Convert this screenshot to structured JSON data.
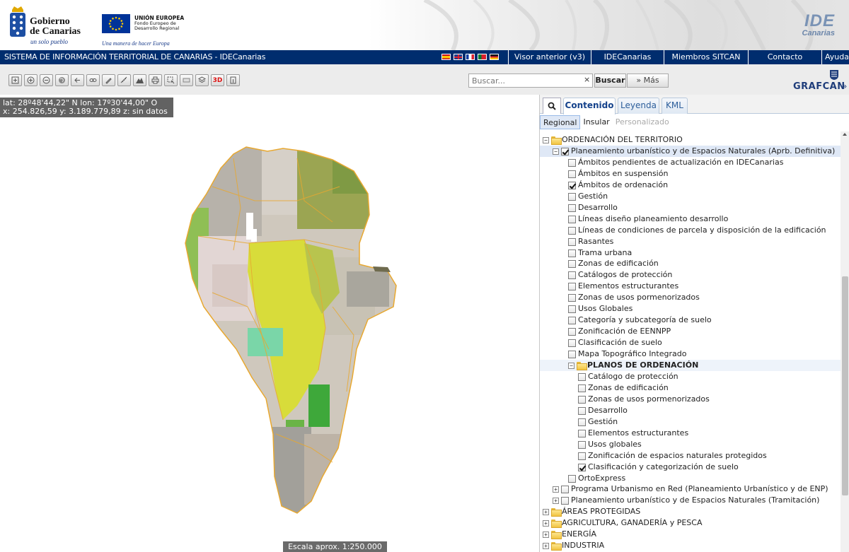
{
  "header": {
    "gob_name": "Gobierno\nde Canarias",
    "gob_slogan": "un solo pueblo",
    "ue_title": "UNIÓN EUROPEA",
    "ue_sub": "Fondo Europeo de\nDesarrollo Regional",
    "ue_slogan": "Una manera de hacer Europa",
    "ide_line1": "IDE",
    "ide_line2": "Canarias"
  },
  "navbar": {
    "system_title": "SISTEMA DE INFORMACIÓN TERRITORIAL DE CANARIAS - IDECanarias",
    "flags": [
      "es",
      "gb",
      "fr",
      "pt",
      "de"
    ],
    "links": [
      "Visor anterior (v3)",
      "IDECanarias",
      "Miembros SITCAN",
      "Contacto",
      "Ayuda"
    ]
  },
  "toolbar": {
    "tools": [
      "zoom-extent-icon",
      "zoom-in-icon",
      "zoom-out-icon",
      "globe-icon",
      "back-icon",
      "link-icon",
      "draw-icon",
      "measure-icon",
      "profile-icon",
      "print-icon",
      "select-icon",
      "legend-icon",
      "layers-icon",
      "3d-icon",
      "info-icon"
    ],
    "tool_3d_label": "3D",
    "search_placeholder": "Buscar...",
    "search_clear": "×",
    "search_button": "Buscar",
    "more_button": "» Más",
    "brand": "GRAFCAN",
    "brand_arrow": "»"
  },
  "map": {
    "coords_line1": "lat: 28º48'44,22\" N  lon: 17º30'44,00\" O",
    "coords_line2": "x: 254.826,59  y: 3.189.779,89  z: sin datos",
    "scale": "Escala aprox. 1:250.000"
  },
  "panel": {
    "tabs": [
      "Contenido",
      "Leyenda",
      "KML"
    ],
    "subtabs": [
      "Regional",
      "Insular",
      "Personalizado"
    ],
    "tree": [
      {
        "type": "folder",
        "level": 0,
        "expander": "−",
        "label": "ORDENACIÓN DEL TERRITORIO"
      },
      {
        "type": "layer",
        "level": 1,
        "expander": "−",
        "checked": true,
        "label": "Planeamiento urbanístico y de Espacios Naturales (Aprb. Definitiva)",
        "selected": true
      },
      {
        "type": "layer",
        "level": 2,
        "checked": false,
        "label": "Ámbitos pendientes de actualización en IDECanarias"
      },
      {
        "type": "layer",
        "level": 2,
        "checked": false,
        "label": "Ámbitos en suspensión"
      },
      {
        "type": "layer",
        "level": 2,
        "checked": true,
        "label": "Ámbitos de ordenación"
      },
      {
        "type": "layer",
        "level": 2,
        "checked": false,
        "label": "Gestión"
      },
      {
        "type": "layer",
        "level": 2,
        "checked": false,
        "label": "Desarrollo"
      },
      {
        "type": "layer",
        "level": 2,
        "checked": false,
        "label": "Líneas diseño planeamiento desarrollo"
      },
      {
        "type": "layer",
        "level": 2,
        "checked": false,
        "label": "Líneas de condiciones de parcela y disposición de la edificación"
      },
      {
        "type": "layer",
        "level": 2,
        "checked": false,
        "label": "Rasantes"
      },
      {
        "type": "layer",
        "level": 2,
        "checked": false,
        "label": "Trama urbana"
      },
      {
        "type": "layer",
        "level": 2,
        "checked": false,
        "label": "Zonas de edificación"
      },
      {
        "type": "layer",
        "level": 2,
        "checked": false,
        "label": "Catálogos de protección"
      },
      {
        "type": "layer",
        "level": 2,
        "checked": false,
        "label": "Elementos estructurantes"
      },
      {
        "type": "layer",
        "level": 2,
        "checked": false,
        "label": "Zonas de usos pormenorizados"
      },
      {
        "type": "layer",
        "level": 2,
        "checked": false,
        "label": "Usos Globales"
      },
      {
        "type": "layer",
        "level": 2,
        "checked": false,
        "label": "Categoría y subcategoría de suelo"
      },
      {
        "type": "layer",
        "level": 2,
        "checked": false,
        "label": "Zonificación de EENNPP"
      },
      {
        "type": "layer",
        "level": 2,
        "checked": false,
        "label": "Clasificación de suelo"
      },
      {
        "type": "layer",
        "level": 2,
        "checked": false,
        "label": "Mapa Topográfico Integrado"
      },
      {
        "type": "folder",
        "level": 2,
        "expander": "−",
        "label": "PLANOS DE ORDENACIÓN",
        "bold": true,
        "highlight": true
      },
      {
        "type": "layer",
        "level": 3,
        "checked": false,
        "label": "Catálogo de protección"
      },
      {
        "type": "layer",
        "level": 3,
        "checked": false,
        "label": "Zonas de edificación"
      },
      {
        "type": "layer",
        "level": 3,
        "checked": false,
        "label": "Zonas de usos pormenorizados"
      },
      {
        "type": "layer",
        "level": 3,
        "checked": false,
        "label": "Desarrollo"
      },
      {
        "type": "layer",
        "level": 3,
        "checked": false,
        "label": "Gestión"
      },
      {
        "type": "layer",
        "level": 3,
        "checked": false,
        "label": "Elementos estructurantes"
      },
      {
        "type": "layer",
        "level": 3,
        "checked": false,
        "label": "Usos globales"
      },
      {
        "type": "layer",
        "level": 3,
        "checked": false,
        "label": "Zonificación de espacios naturales protegidos"
      },
      {
        "type": "layer",
        "level": 3,
        "checked": true,
        "label": "Clasificación y categorización de suelo"
      },
      {
        "type": "layer",
        "level": 2,
        "checked": false,
        "label": "OrtoExpress"
      },
      {
        "type": "layer",
        "level": 1,
        "expander": "+",
        "checked": false,
        "label": "Programa Urbanismo en Red (Planeamiento Urbanístico y de ENP)"
      },
      {
        "type": "layer",
        "level": 1,
        "expander": "+",
        "checked": false,
        "label": "Planeamiento urbanístico y de Espacios Naturales (Tramitación)"
      },
      {
        "type": "folder",
        "level": 0,
        "expander": "+",
        "label": "ÁREAS PROTEGIDAS"
      },
      {
        "type": "folder",
        "level": 0,
        "expander": "+",
        "label": "AGRICULTURA, GANADERÍA y PESCA"
      },
      {
        "type": "folder",
        "level": 0,
        "expander": "+",
        "label": "ENERGÍA"
      },
      {
        "type": "folder",
        "level": 0,
        "expander": "+",
        "label": "INDUSTRIA"
      }
    ]
  }
}
